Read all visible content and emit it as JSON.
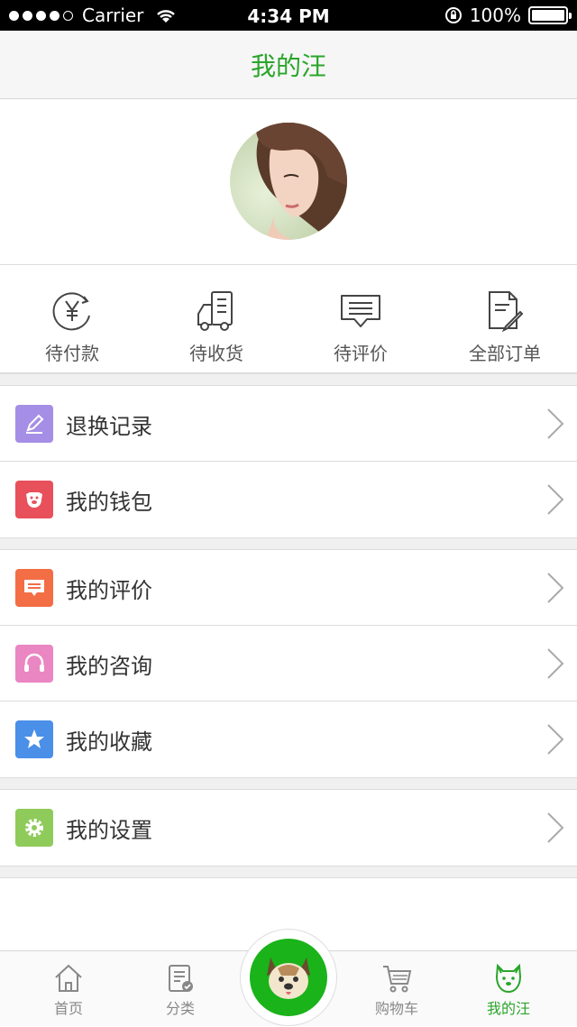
{
  "status_bar": {
    "carrier": "Carrier",
    "time": "4:34 PM",
    "battery": "100%"
  },
  "nav": {
    "title": "我的汪"
  },
  "orders": [
    {
      "label": "待付款",
      "icon": "yuan-icon"
    },
    {
      "label": "待收货",
      "icon": "truck-icon"
    },
    {
      "label": "待评价",
      "icon": "comment-icon"
    },
    {
      "label": "全部订单",
      "icon": "document-icon"
    }
  ],
  "menu": [
    {
      "label": "退换记录",
      "icon": "pencil-icon",
      "color": "#a58ee6"
    },
    {
      "label": "我的钱包",
      "icon": "piggy-bank-icon",
      "color": "#e8505b"
    },
    {
      "label": "我的评价",
      "icon": "message-icon",
      "color": "#f36d45"
    },
    {
      "label": "我的咨询",
      "icon": "headset-icon",
      "color": "#ea86c2"
    },
    {
      "label": "我的收藏",
      "icon": "star-icon",
      "color": "#4a8fe8"
    },
    {
      "label": "我的设置",
      "icon": "gear-icon",
      "color": "#8fcb5a"
    }
  ],
  "tabs": [
    {
      "label": "首页",
      "icon": "home-icon"
    },
    {
      "label": "分类",
      "icon": "clipboard-icon"
    },
    {
      "label": "购物车",
      "icon": "cart-icon"
    },
    {
      "label": "我的汪",
      "icon": "dog-icon",
      "active": true
    }
  ],
  "colors": {
    "accent": "#2aa52a",
    "center_button": "#1ab31a"
  }
}
